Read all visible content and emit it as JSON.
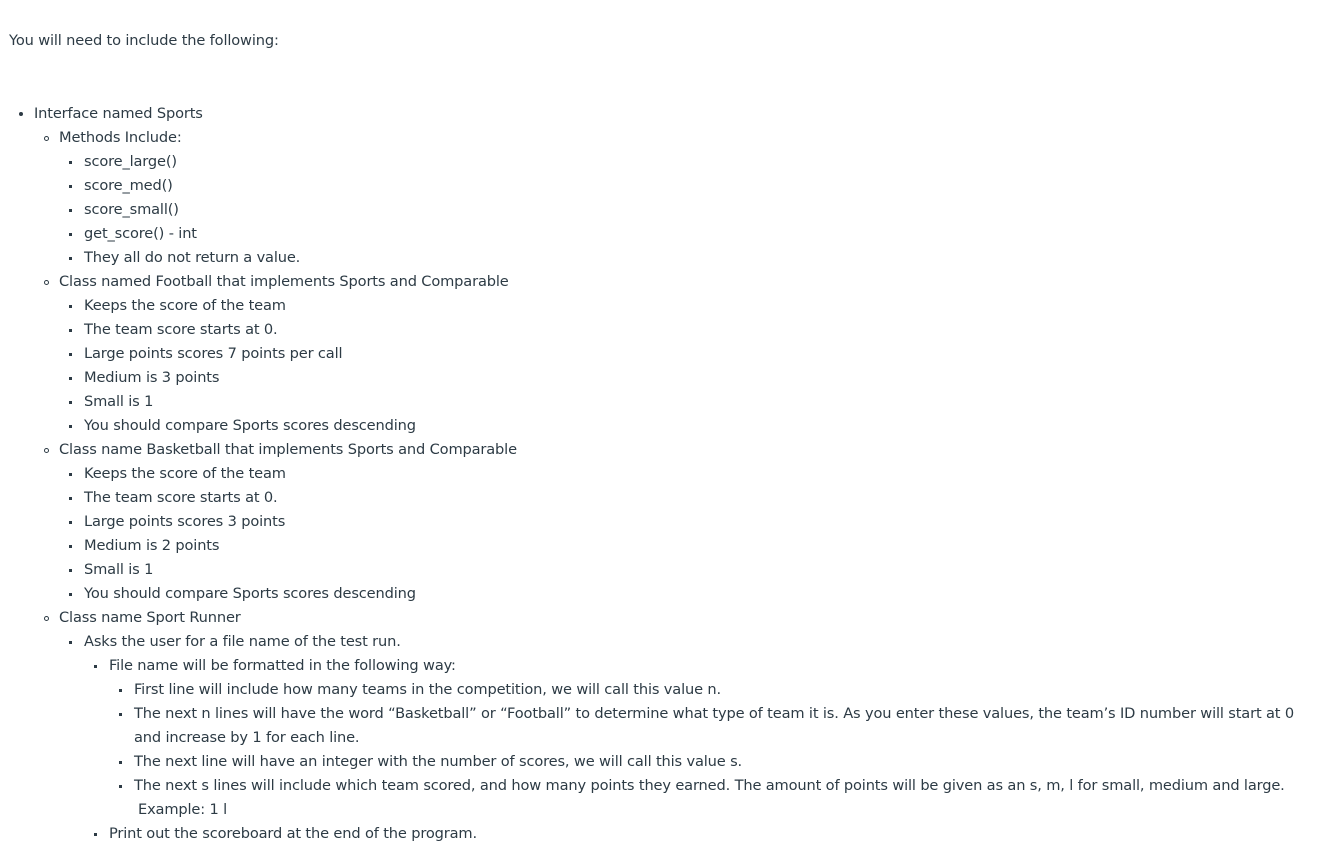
{
  "intro": "You will need to include the following:",
  "interface": {
    "label": "Interface named Sports",
    "methods": {
      "label": "Methods Include:",
      "items": [
        "score_large()",
        "score_med()",
        "score_small()",
        "get_score() - int",
        "They all do not return a value."
      ]
    },
    "football": {
      "label": "Class named Football that implements Sports and Comparable",
      "items": [
        "Keeps the score of the team",
        "The team score starts at 0.",
        "Large points scores 7 points per call",
        "Medium is 3 points",
        "Small is 1",
        "You should compare Sports scores descending"
      ]
    },
    "basketball": {
      "label": "Class name Basketball that implements Sports and Comparable",
      "items": [
        "Keeps the score of the team",
        "The team score starts at 0.",
        "Large points scores 3 points",
        "Medium is 2 points",
        "Small is 1",
        "You should compare Sports scores descending"
      ]
    },
    "runner": {
      "label": "Class name Sport Runner",
      "asks": "Asks the user for a file name of the test run.",
      "format": {
        "label": "File name will be formatted in the following way:",
        "items": [
          "First line will include how many teams in the competition, we will call this value n.",
          "The next n lines will have the word “Basketball” or “Football” to determine what type of team it is. As you enter these values, the team’s ID number will start at 0 and increase by 1 for each line.",
          "The next line will have an integer with the number of scores, we will call this value s.",
          "The next s lines will include which team scored, and how many points they earned. The amount of points will be given as an s, m, l for small, medium and large."
        ],
        "example": "Example: 1 l"
      },
      "print": "Print out the scoreboard at the end of the program."
    }
  }
}
